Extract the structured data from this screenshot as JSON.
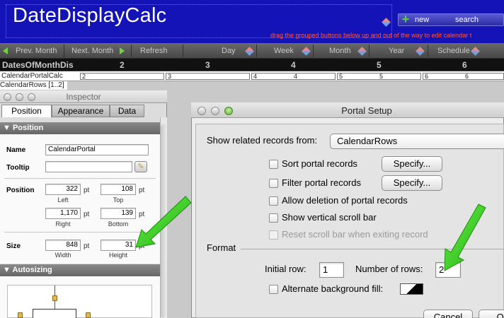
{
  "header": {
    "title": "DateDisplayCalc",
    "buttons": {
      "new": "new",
      "search": "search"
    },
    "drag_hint": "drag the grouped buttons below up and out of the way to edit calendar t"
  },
  "nav": {
    "prev_month": "Prev. Month",
    "next_month": "Next. Month",
    "refresh": "Refresh",
    "day": "Day",
    "week": "Week",
    "month": "Month",
    "year": "Year",
    "schedule": "Schedule"
  },
  "dates_row": {
    "title": "DatesOfMonthDis",
    "numbers": [
      "2",
      "3",
      "4",
      "5",
      "6"
    ]
  },
  "portal": {
    "label": "CalendarPortalCalc",
    "rows_label": "CalendarRows [1..2]",
    "cells": [
      "2",
      "3",
      "4",
      "4",
      "5",
      "5",
      "6",
      "6"
    ]
  },
  "inspector": {
    "title": "Inspector",
    "tabs": [
      "Position",
      "Appearance",
      "Data"
    ],
    "section_position": "Position",
    "section_autosizing": "Autosizing",
    "name_label": "Name",
    "name_value": "CalendarPortal",
    "tooltip_label": "Tooltip",
    "tooltip_value": "",
    "position_label": "Position",
    "left": "322",
    "top": "108",
    "right": "1,170",
    "bottom": "139",
    "left_label": "Left",
    "top_label": "Top",
    "right_label": "Right",
    "bottom_label": "Bottom",
    "size_label": "Size",
    "width": "848",
    "height": "31",
    "width_label": "Width",
    "height_label": "Height",
    "unit": "pt"
  },
  "portal_setup": {
    "title": "Portal Setup",
    "related_label": "Show related records from:",
    "related_value": "CalendarRows",
    "sort_label": "Sort portal records",
    "filter_label": "Filter portal records",
    "specify": "Specify...",
    "allow_delete_label": "Allow deletion of portal records",
    "vscroll_label": "Show vertical scroll bar",
    "reset_scroll_label": "Reset scroll bar when exiting record",
    "format_label": "Format",
    "initial_row_label": "Initial row:",
    "initial_row_value": "1",
    "num_rows_label": "Number of rows:",
    "num_rows_value": "2",
    "alt_bg_label": "Alternate background fill:",
    "cancel": "Cancel",
    "ok": "OK"
  },
  "colors": {
    "header_blue": "#1313b8",
    "arrow_green": "#39d21a",
    "hint_red": "#ff5a3c"
  }
}
